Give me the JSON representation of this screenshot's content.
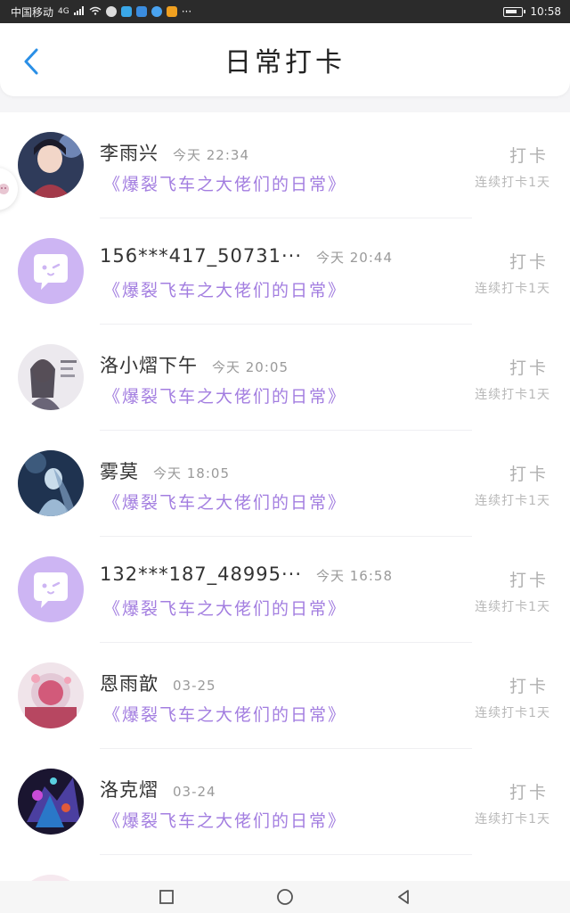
{
  "status_bar": {
    "carrier": "中国移动",
    "network": "4G",
    "time": "10:58",
    "more": "···"
  },
  "header": {
    "title": "日常打卡"
  },
  "checkins": [
    {
      "name": "李雨兴",
      "time": "今天 22:34",
      "group": "《爆裂飞车之大佬们的日常》",
      "action": "打卡",
      "streak": "连续打卡1天",
      "avatar": "avatar-photo"
    },
    {
      "name": "156***417_50731···",
      "time": "今天 20:44",
      "group": "《爆裂飞车之大佬们的日常》",
      "action": "打卡",
      "streak": "连续打卡1天",
      "avatar": "default-avatar"
    },
    {
      "name": "洛小熠下午",
      "time": "今天 20:05",
      "group": "《爆裂飞车之大佬们的日常》",
      "action": "打卡",
      "streak": "连续打卡1天",
      "avatar": "avatar-photo"
    },
    {
      "name": "雾莫",
      "time": "今天 18:05",
      "group": "《爆裂飞车之大佬们的日常》",
      "action": "打卡",
      "streak": "连续打卡1天",
      "avatar": "avatar-photo"
    },
    {
      "name": "132***187_48995···",
      "time": "今天 16:58",
      "group": "《爆裂飞车之大佬们的日常》",
      "action": "打卡",
      "streak": "连续打卡1天",
      "avatar": "default-avatar"
    },
    {
      "name": "恩雨歆",
      "time": "03-25",
      "group": "《爆裂飞车之大佬们的日常》",
      "action": "打卡",
      "streak": "连续打卡1天",
      "avatar": "avatar-photo"
    },
    {
      "name": "洛克熠",
      "time": "03-24",
      "group": "《爆裂飞车之大佬们的日常》",
      "action": "打卡",
      "streak": "连续打卡1天",
      "avatar": "avatar-photo"
    }
  ],
  "colors": {
    "accent_blue": "#2a8fe6",
    "group_purple": "#a37ee0",
    "default_avatar_bg": "#cdb5f3"
  },
  "nav_bar": {
    "icons": [
      "recent-apps-icon",
      "home-icon",
      "back-icon"
    ]
  }
}
